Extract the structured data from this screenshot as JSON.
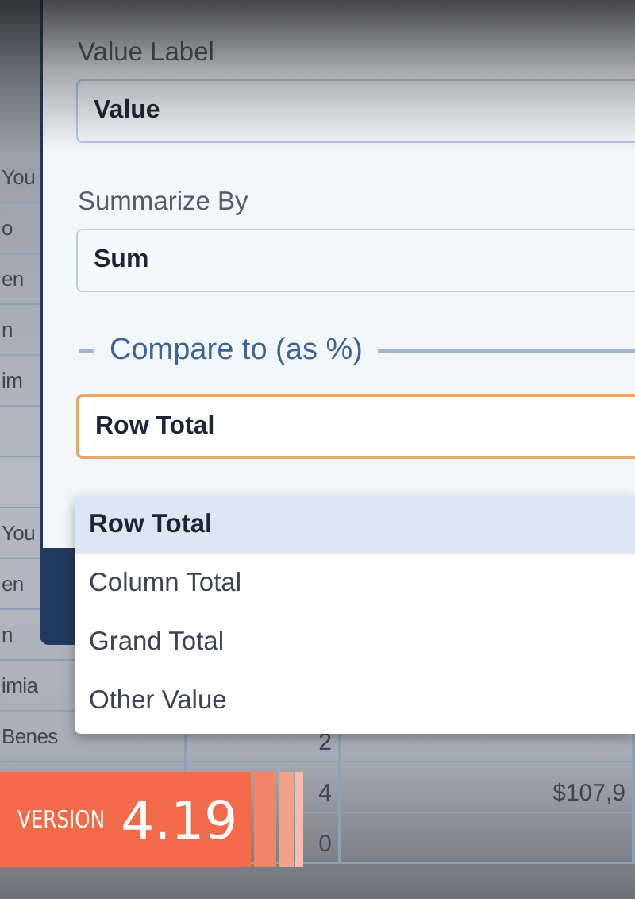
{
  "background_table": {
    "rows": [
      {
        "column_1": "You"
      },
      {
        "column_1": "o"
      },
      {
        "column_1": "en"
      },
      {
        "column_1": "n"
      },
      {
        "column_1": "im"
      },
      {},
      {},
      {
        "column_1": "You"
      },
      {
        "column_1": "en"
      },
      {
        "column_1": "n"
      },
      {
        "column_1": "imia"
      },
      {
        "column_1": "Benes",
        "column_2": "2"
      },
      {
        "column_2": "4",
        "column_3": "$107,9"
      },
      {
        "column_2": "0"
      }
    ]
  },
  "panel": {
    "value_label": {
      "label": "Value Label",
      "value": "Value"
    },
    "summarize_by": {
      "label": "Summarize By",
      "value": "Sum"
    },
    "compare_section": {
      "title": "Compare to (as %)",
      "select": {
        "value": "Row Total",
        "focused": true,
        "options": [
          {
            "label": "Row Total",
            "selected": true
          },
          {
            "label": "Column Total",
            "selected": false
          },
          {
            "label": "Grand Total",
            "selected": false
          },
          {
            "label": "Other Value",
            "selected": false
          }
        ]
      }
    }
  },
  "badge": {
    "label": "VERSION",
    "version": "4.19"
  }
}
